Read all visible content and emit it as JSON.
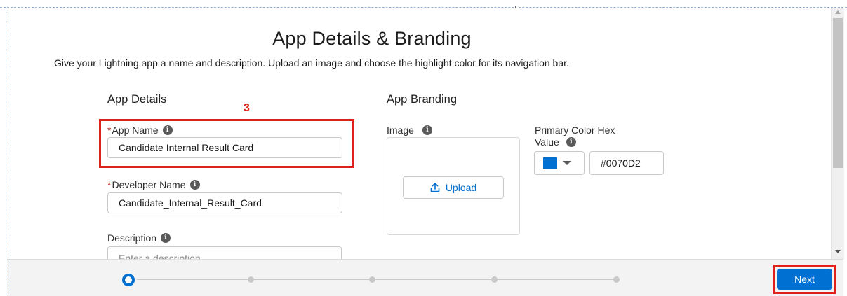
{
  "page": {
    "title": "App Details & Branding",
    "subtitle": "Give your Lightning app a name and description. Upload an image and choose the highlight color for its navigation bar."
  },
  "annotation": {
    "step_number": "3"
  },
  "app_details": {
    "heading": "App Details",
    "app_name": {
      "label": "App Name",
      "required_marker": "*",
      "value": "Candidate Internal Result Card"
    },
    "developer_name": {
      "label": "Developer Name",
      "required_marker": "*",
      "value": "Candidate_Internal_Result_Card"
    },
    "description": {
      "label": "Description",
      "placeholder": "Enter a description..."
    }
  },
  "app_branding": {
    "heading": "App Branding",
    "image": {
      "label": "Image",
      "upload_label": "Upload"
    },
    "primary_color": {
      "label_line1": "Primary Color Hex",
      "label_line2": "Value",
      "hex_value": "#0070D2",
      "swatch_color": "#0070D2"
    }
  },
  "icons": {
    "info": "info-icon",
    "upload": "upload-icon",
    "dropdown": "chevron-down-icon"
  },
  "footer": {
    "progress": {
      "total_steps": 5,
      "current_step": 1
    },
    "next_label": "Next"
  },
  "colors": {
    "brand": "#0070D2",
    "annotation_red": "#E0201A",
    "required": "#C23934"
  }
}
